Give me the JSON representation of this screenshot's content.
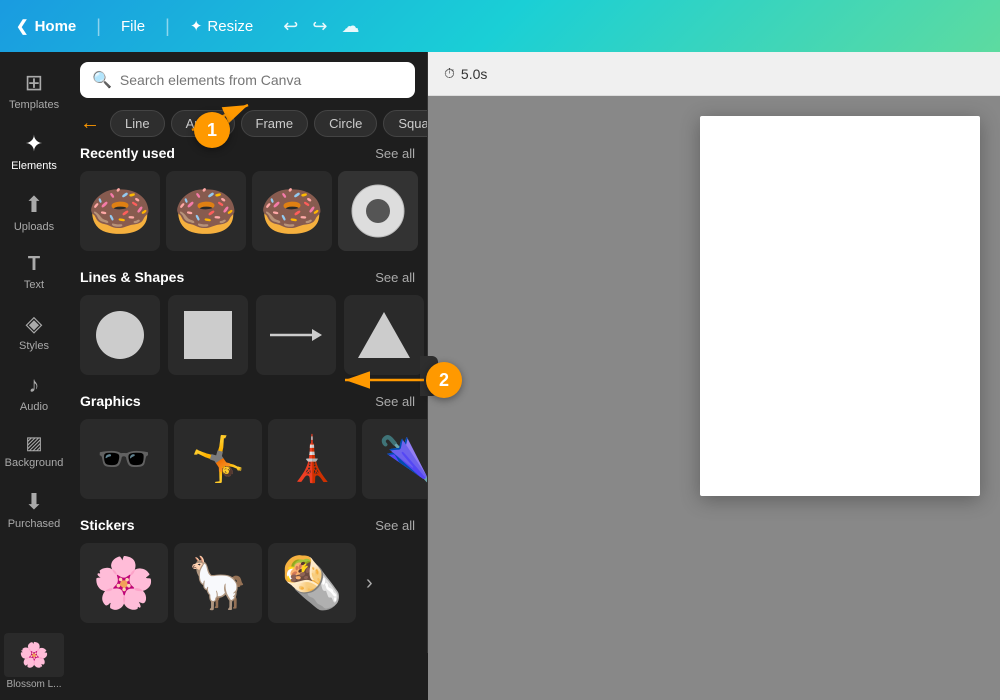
{
  "topbar": {
    "home_label": "Home",
    "file_label": "File",
    "resize_label": "Resize",
    "undo_icon": "↩",
    "redo_icon": "↪",
    "cloud_icon": "☁"
  },
  "sidebar_icons": [
    {
      "id": "templates",
      "icon": "⊞",
      "label": "Templates"
    },
    {
      "id": "elements",
      "icon": "✦",
      "label": "Elements",
      "active": true
    },
    {
      "id": "uploads",
      "icon": "↑",
      "label": "Uploads"
    },
    {
      "id": "text",
      "icon": "T",
      "label": "Text"
    },
    {
      "id": "styles",
      "icon": "◈",
      "label": "Styles"
    },
    {
      "id": "audio",
      "icon": "♪",
      "label": "Audio"
    },
    {
      "id": "background",
      "icon": "▨",
      "label": "Background"
    },
    {
      "id": "purchased",
      "icon": "↓",
      "label": "Purchased"
    }
  ],
  "search": {
    "placeholder": "Search elements from Canva",
    "icon": "🔍"
  },
  "filter_tags": [
    {
      "label": "Line"
    },
    {
      "label": "Arrow"
    },
    {
      "label": "Frame"
    },
    {
      "label": "Circle"
    },
    {
      "label": "Square"
    }
  ],
  "sections": {
    "recently_used": {
      "title": "Recently used",
      "see_all": "See all"
    },
    "lines_shapes": {
      "title": "Lines & Shapes",
      "see_all": "See all"
    },
    "graphics": {
      "title": "Graphics",
      "see_all": "See all"
    },
    "stickers": {
      "title": "Stickers",
      "see_all": "See all"
    }
  },
  "canvas": {
    "timer": "5.0s",
    "timer_icon": "⏱"
  },
  "annotations": [
    {
      "number": "1"
    },
    {
      "number": "2"
    }
  ],
  "blossom": {
    "label": "Blossom L..."
  }
}
